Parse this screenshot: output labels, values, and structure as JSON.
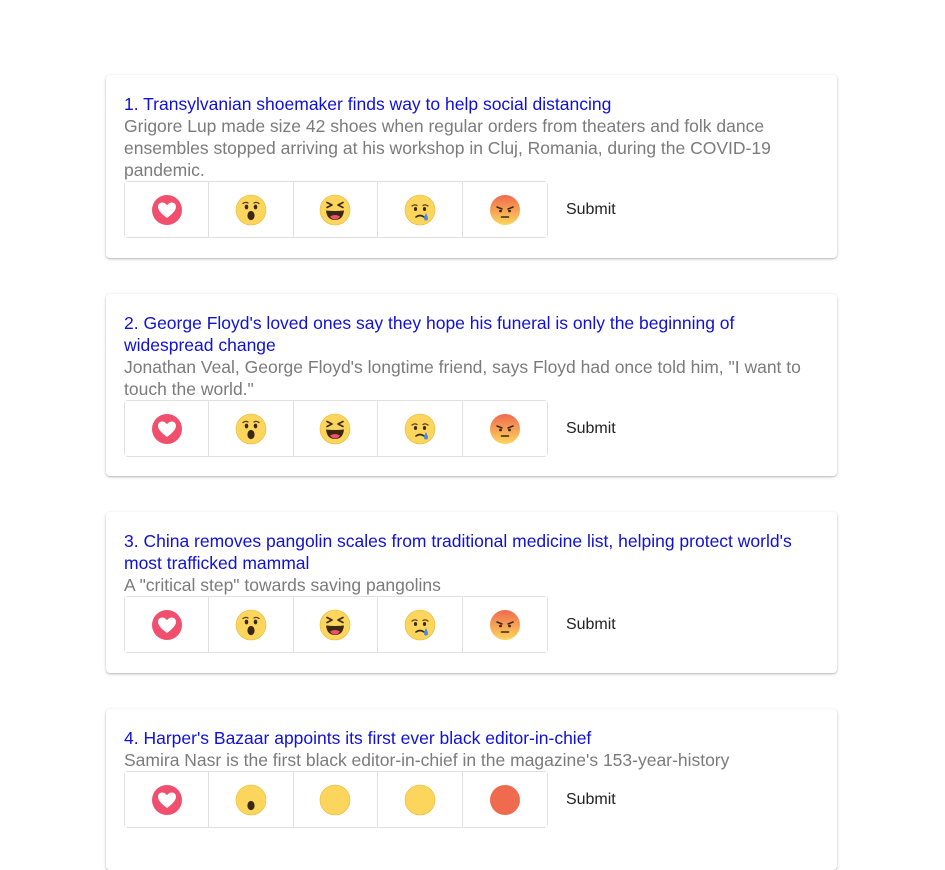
{
  "articles": [
    {
      "title": "1. Transylvanian shoemaker finds way to help social distancing",
      "description": "Grigore Lup made size 42 shoes when regular orders from theaters and folk dance ensembles stopped arriving at his workshop in Cluj, Romania, during the COVID-19 pandemic.",
      "submit_label": "Submit"
    },
    {
      "title": "2. George Floyd's loved ones say they hope his funeral is only the beginning of widespread change",
      "description": "Jonathan Veal, George Floyd's longtime friend, says Floyd had once told him, \"I want to touch the world.\"",
      "submit_label": "Submit"
    },
    {
      "title": "3. China removes pangolin scales from traditional medicine list, helping protect world's most trafficked mammal",
      "description": "A \"critical step\" towards saving pangolins",
      "submit_label": "Submit"
    },
    {
      "title": "4. Harper's Bazaar appoints its first ever black editor-in-chief",
      "description": "Samira Nasr is the first black editor-in-chief in the magazine's 153-year-history",
      "submit_label": "Submit"
    }
  ],
  "reactions": [
    "love-icon",
    "wow-icon",
    "haha-icon",
    "sad-icon",
    "angry-icon"
  ],
  "colors": {
    "title_link": "#1010d8",
    "description": "#7b7b7b",
    "love": "#f0506e",
    "emoji_yellow": "#fcd65c",
    "angry_top": "#f06a4e"
  }
}
